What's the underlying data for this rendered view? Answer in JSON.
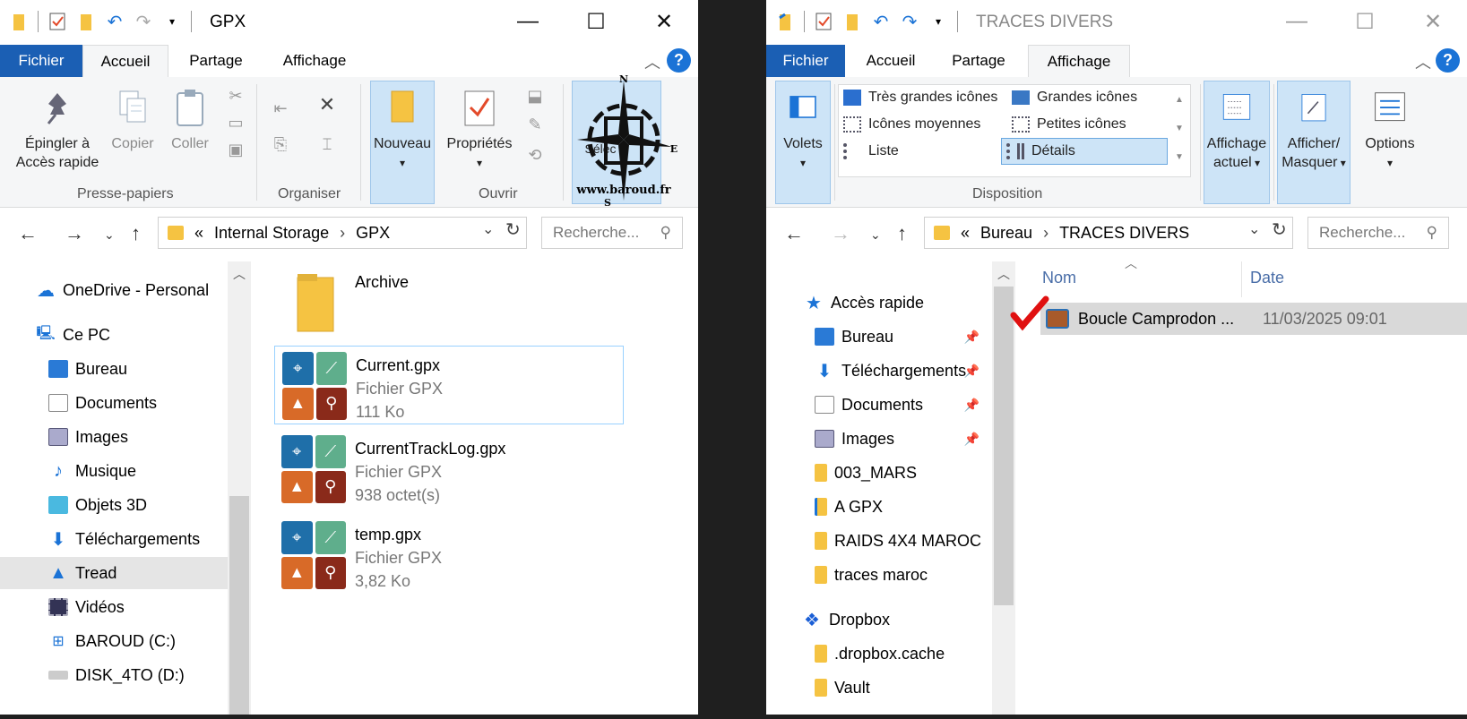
{
  "left": {
    "title": "GPX",
    "tabs": [
      "Fichier",
      "Accueil",
      "Partage",
      "Affichage"
    ],
    "help": "?",
    "ribbon": {
      "pin": "Épingler à Accès rapide",
      "copy": "Copier",
      "paste": "Coller",
      "new": "Nouveau",
      "props": "Propriétés",
      "select": "Sélec",
      "groups": [
        "Presse-papiers",
        "Organiser",
        "Ouvrir"
      ]
    },
    "address": {
      "prefix": "«",
      "parts": [
        "Internal Storage",
        "GPX"
      ],
      "search_placeholder": "Recherche..."
    },
    "nav": [
      {
        "label": "OneDrive - Personal"
      },
      {
        "label": "Ce PC"
      },
      {
        "label": "Bureau"
      },
      {
        "label": "Documents"
      },
      {
        "label": "Images"
      },
      {
        "label": "Musique"
      },
      {
        "label": "Objets 3D"
      },
      {
        "label": "Téléchargements"
      },
      {
        "label": "Tread"
      },
      {
        "label": "Vidéos"
      },
      {
        "label": "BAROUD (C:)"
      },
      {
        "label": "DISK_4TO (D:)"
      }
    ],
    "files": [
      {
        "name": "Archive"
      },
      {
        "name": "Current.gpx",
        "type": "Fichier GPX",
        "size": "111 Ko"
      },
      {
        "name": "CurrentTrackLog.gpx",
        "type": "Fichier GPX",
        "size": "938 octet(s)"
      },
      {
        "name": "temp.gpx",
        "type": "Fichier GPX",
        "size": "3,82 Ko"
      }
    ],
    "watermark": "www.baroud.fr",
    "compass": {
      "n": "N",
      "e": "E",
      "s": "S"
    }
  },
  "right": {
    "title": "TRACES DIVERS",
    "tabs": [
      "Fichier",
      "Accueil",
      "Partage",
      "Affichage"
    ],
    "help": "?",
    "ribbon": {
      "volets": "Volets",
      "layouts": [
        "Très grandes icônes",
        "Grandes icônes",
        "Icônes moyennes",
        "Petites icônes",
        "Liste",
        "Détails"
      ],
      "current_view": "Affichage actuel",
      "show_hide": "Afficher/ Masquer",
      "options": "Options",
      "group": "Disposition"
    },
    "address": {
      "prefix": "«",
      "parts": [
        "Bureau",
        "TRACES DIVERS"
      ],
      "search_placeholder": "Recherche..."
    },
    "nav": [
      {
        "label": "Accès rapide"
      },
      {
        "label": "Bureau"
      },
      {
        "label": "Téléchargements"
      },
      {
        "label": "Documents"
      },
      {
        "label": "Images"
      },
      {
        "label": "003_MARS"
      },
      {
        "label": "A GPX"
      },
      {
        "label": "RAIDS 4X4 MAROC"
      },
      {
        "label": "traces maroc"
      },
      {
        "label": "Dropbox"
      },
      {
        "label": ".dropbox.cache"
      },
      {
        "label": "Vault"
      }
    ],
    "columns": [
      "Nom",
      "Date"
    ],
    "row": {
      "name": "Boucle Camprodon ...",
      "date": "11/03/2025 09:01"
    }
  },
  "colors": {
    "accent": "#1b5fb4",
    "folder": "#f5c342",
    "selection": "#cde4f7"
  }
}
